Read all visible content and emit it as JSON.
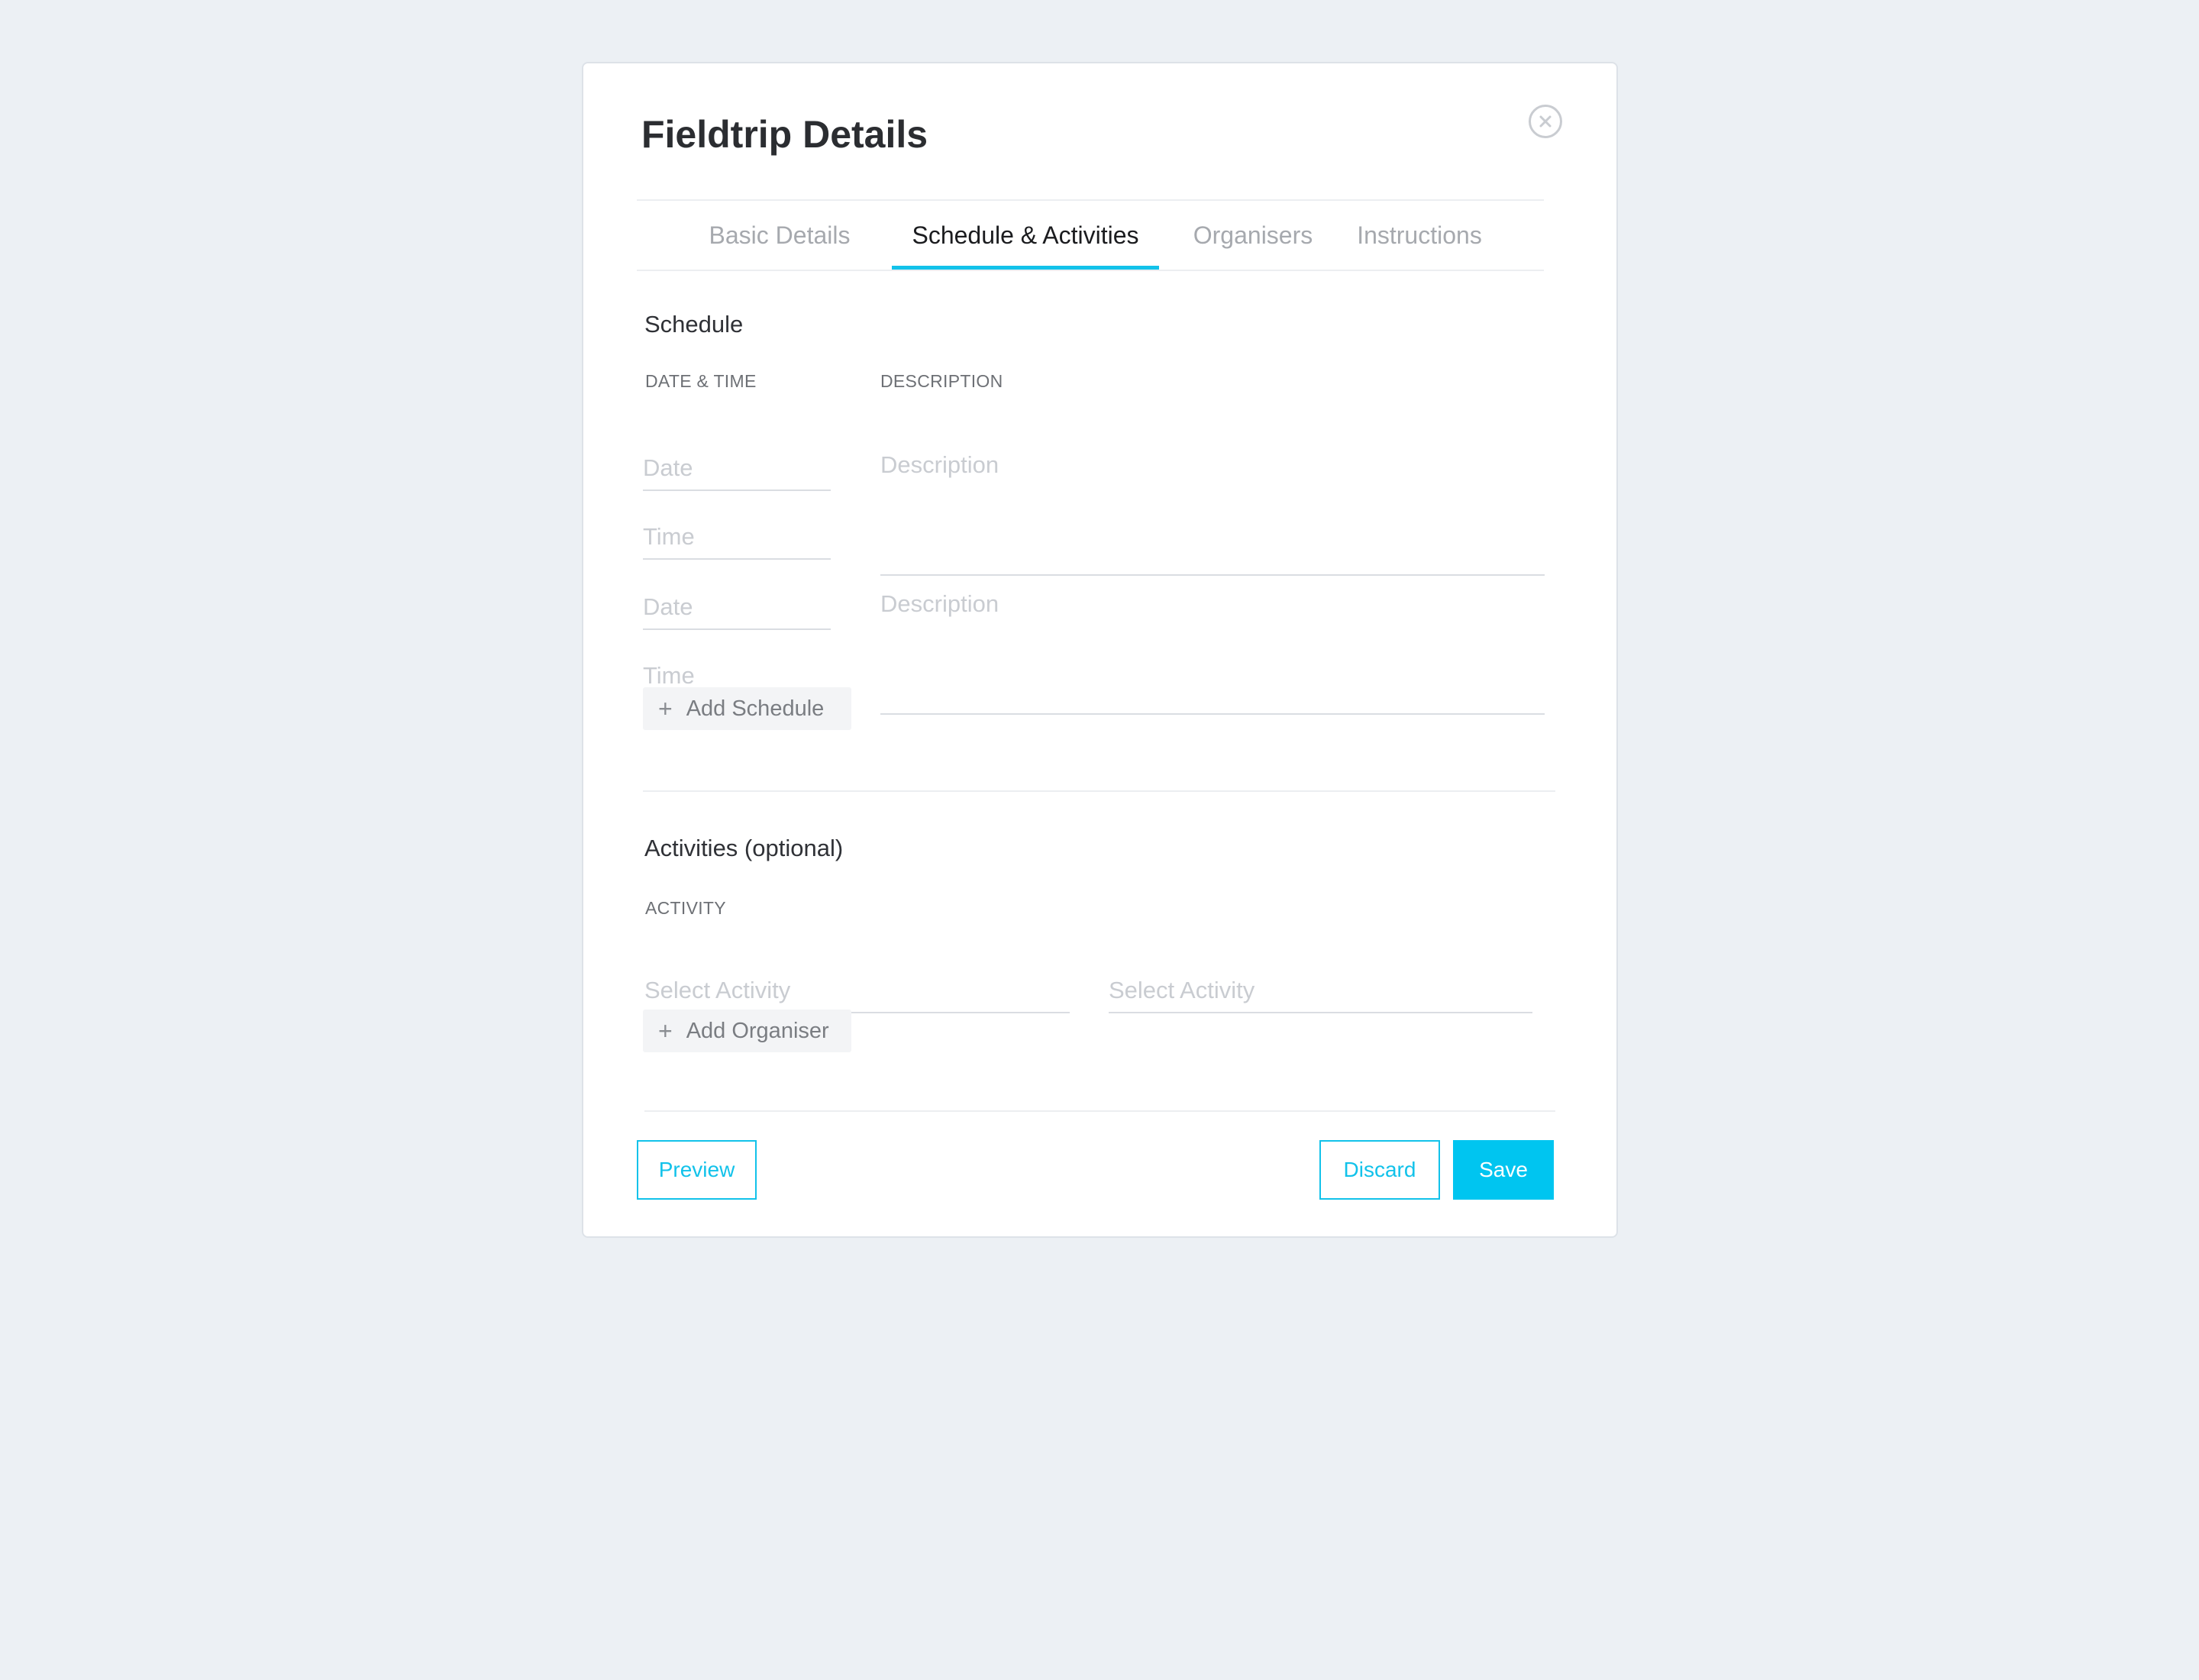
{
  "modal": {
    "title": "Fieldtrip Details",
    "close_icon": "close-circle-icon"
  },
  "tabs": [
    {
      "label": "Basic Details",
      "active": false
    },
    {
      "label": "Schedule & Activities",
      "active": true
    },
    {
      "label": "Organisers",
      "active": false
    },
    {
      "label": "Instructions",
      "active": false
    }
  ],
  "accent_color": "#12c2ea",
  "schedule": {
    "title": "Schedule",
    "date_time_label": "DATE & TIME",
    "description_label": "DESCRIPTION",
    "entries": [
      {
        "date_placeholder": "Date",
        "time_placeholder": "Time",
        "description_placeholder": "Description"
      },
      {
        "date_placeholder": "Date",
        "time_placeholder": "Time",
        "description_placeholder": "Description"
      }
    ],
    "add_button_label": "Add Schedule",
    "add_icon": "plus-icon"
  },
  "activities": {
    "title": "Activities (optional)",
    "activity_label": "ACTIVITY",
    "selects": [
      {
        "placeholder": "Select Activity"
      },
      {
        "placeholder": "Select Activity"
      }
    ],
    "add_button_label": "Add Organiser",
    "add_icon": "plus-icon"
  },
  "footer": {
    "preview_label": "Preview",
    "discard_label": "Discard",
    "save_label": "Save"
  }
}
